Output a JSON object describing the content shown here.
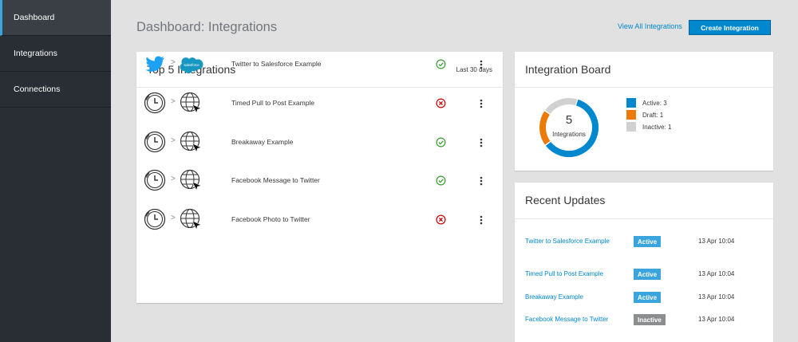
{
  "sidebar": {
    "items": [
      {
        "label": "Dashboard",
        "active": true
      },
      {
        "label": "Integrations",
        "active": false
      },
      {
        "label": "Connections",
        "active": false
      }
    ]
  },
  "header": {
    "title": "Dashboard: Integrations",
    "view_all_label": "View All Integrations",
    "create_label": "Create Integration"
  },
  "top5": {
    "title": "Top 5 Integrations",
    "range": "Last 30 days",
    "rows": [
      {
        "name": "Twitter to Salesforce Example",
        "status": "success",
        "from_icon": "twitter-icon",
        "to_icon": "salesforce-icon"
      },
      {
        "name": "Timed Pull to Post Example",
        "status": "error",
        "from_icon": "timer-icon",
        "to_icon": "web-cursor-icon"
      },
      {
        "name": "Breakaway Example",
        "status": "success",
        "from_icon": "timer-icon",
        "to_icon": "web-cursor-icon"
      },
      {
        "name": "Facebook Message to Twitter",
        "status": "success",
        "from_icon": "timer-icon",
        "to_icon": "web-cursor-icon"
      },
      {
        "name": "Facebook Photo to Twitter",
        "status": "error",
        "from_icon": "timer-icon",
        "to_icon": "web-cursor-icon"
      }
    ],
    "salesforce_logo_text": "salesforce"
  },
  "board": {
    "title": "Integration Board",
    "total": "5",
    "total_label": "Integrations",
    "legend": [
      {
        "label": "Active: 3",
        "value": 3,
        "color": "#0088ce"
      },
      {
        "label": "Draft: 1",
        "value": 1,
        "color": "#ec7a08"
      },
      {
        "label": "Inactive: 1",
        "value": 1,
        "color": "#d1d1d1"
      }
    ]
  },
  "updates": {
    "title": "Recent Updates",
    "rows": [
      {
        "name": "Twitter to Salesforce Example",
        "status": "Active",
        "color": "#39a5dc",
        "date": "13 Apr 10:04"
      },
      {
        "name": "Timed Pull to Post Example",
        "status": "Active",
        "color": "#39a5dc",
        "date": "13 Apr 10:04"
      },
      {
        "name": "Breakaway Example",
        "status": "Active",
        "color": "#39a5dc",
        "date": "13 Apr 10:04"
      },
      {
        "name": "Facebook Message to Twitter",
        "status": "Inactive",
        "color": "#8b8d8f",
        "date": "13 Apr 10:04"
      }
    ]
  }
}
